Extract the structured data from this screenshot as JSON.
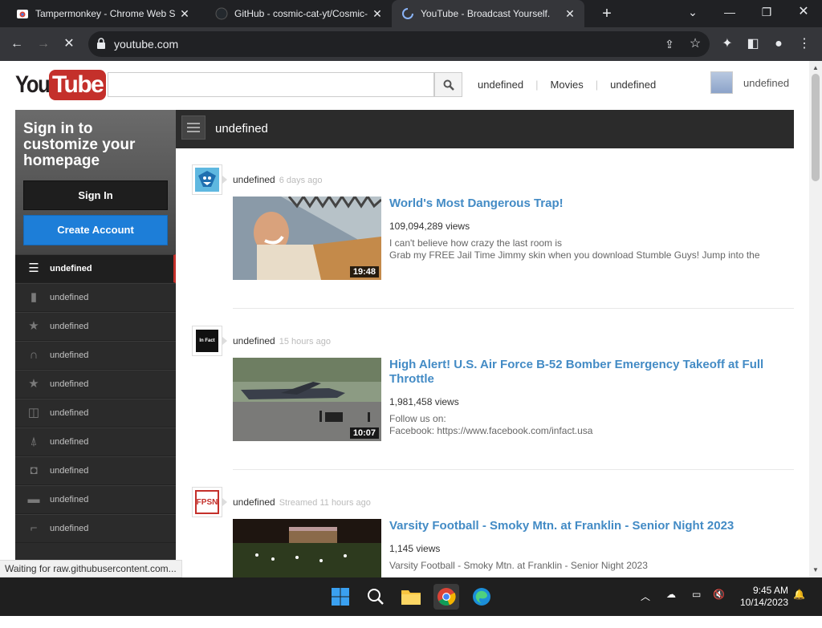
{
  "browser": {
    "tabs": [
      {
        "title": "Tampermonkey - Chrome Web S",
        "active": false
      },
      {
        "title": "GitHub - cosmic-cat-yt/Cosmic-",
        "active": false
      },
      {
        "title": "YouTube - Broadcast Yourself.",
        "active": true
      }
    ],
    "new_tab": "+",
    "url": "youtube.com",
    "status_text": "Waiting for raw.githubusercontent.com..."
  },
  "youtube": {
    "logo_you": "You",
    "logo_tube": "Tube",
    "search": {
      "value": "",
      "placeholder": ""
    },
    "top_links": [
      "undefined",
      "Movies",
      "undefined"
    ],
    "user_name": "undefined",
    "sidebar": {
      "signin_title": "Sign in to customize your homepage",
      "signin_button": "Sign In",
      "create_button": "Create Account",
      "items": [
        {
          "icon": "list-icon",
          "label": "undefined",
          "active": true
        },
        {
          "icon": "bar-chart-icon",
          "label": "undefined",
          "active": false
        },
        {
          "icon": "star-icon",
          "label": "undefined",
          "active": false
        },
        {
          "icon": "headphones-icon",
          "label": "undefined",
          "active": false
        },
        {
          "icon": "star-icon",
          "label": "undefined",
          "active": false
        },
        {
          "icon": "gamepad-icon",
          "label": "undefined",
          "active": false
        },
        {
          "icon": "antenna-icon",
          "label": "undefined",
          "active": false
        },
        {
          "icon": "robot-icon",
          "label": "undefined",
          "active": false
        },
        {
          "icon": "book-icon",
          "label": "undefined",
          "active": false
        },
        {
          "icon": "high-heel-icon",
          "label": "undefined",
          "active": false
        }
      ]
    },
    "feed_title": "undefined",
    "feed": [
      {
        "author": "undefined",
        "when": "6 days ago",
        "title": "World's Most Dangerous Trap!",
        "views": "109,094,289 views",
        "desc1": "I can't believe how crazy the last room is",
        "desc2": "Grab my FREE Jail Time Jimmy skin when you download Stumble Guys! Jump into the",
        "duration": "19:48"
      },
      {
        "author": "undefined",
        "when": "15 hours ago",
        "title": "High Alert! U.S. Air Force B-52 Bomber Emergency Takeoff at Full Throttle",
        "views": "1,981,458 views",
        "desc1": "Follow us on:",
        "desc2": "Facebook: https://www.facebook.com/infact.usa",
        "duration": "10:07",
        "avatar_text": "In Fact"
      },
      {
        "author": "undefined",
        "when": "Streamed 11 hours ago",
        "title": "Varsity Football - Smoky Mtn. at Franklin - Senior Night 2023",
        "views": "1,145 views",
        "desc1": "Varsity Football - Smoky Mtn. at Franklin - Senior Night 2023",
        "desc2": "",
        "avatar_text": "FPSN"
      }
    ]
  },
  "taskbar": {
    "time": "9:45 AM",
    "date": "10/14/2023"
  }
}
